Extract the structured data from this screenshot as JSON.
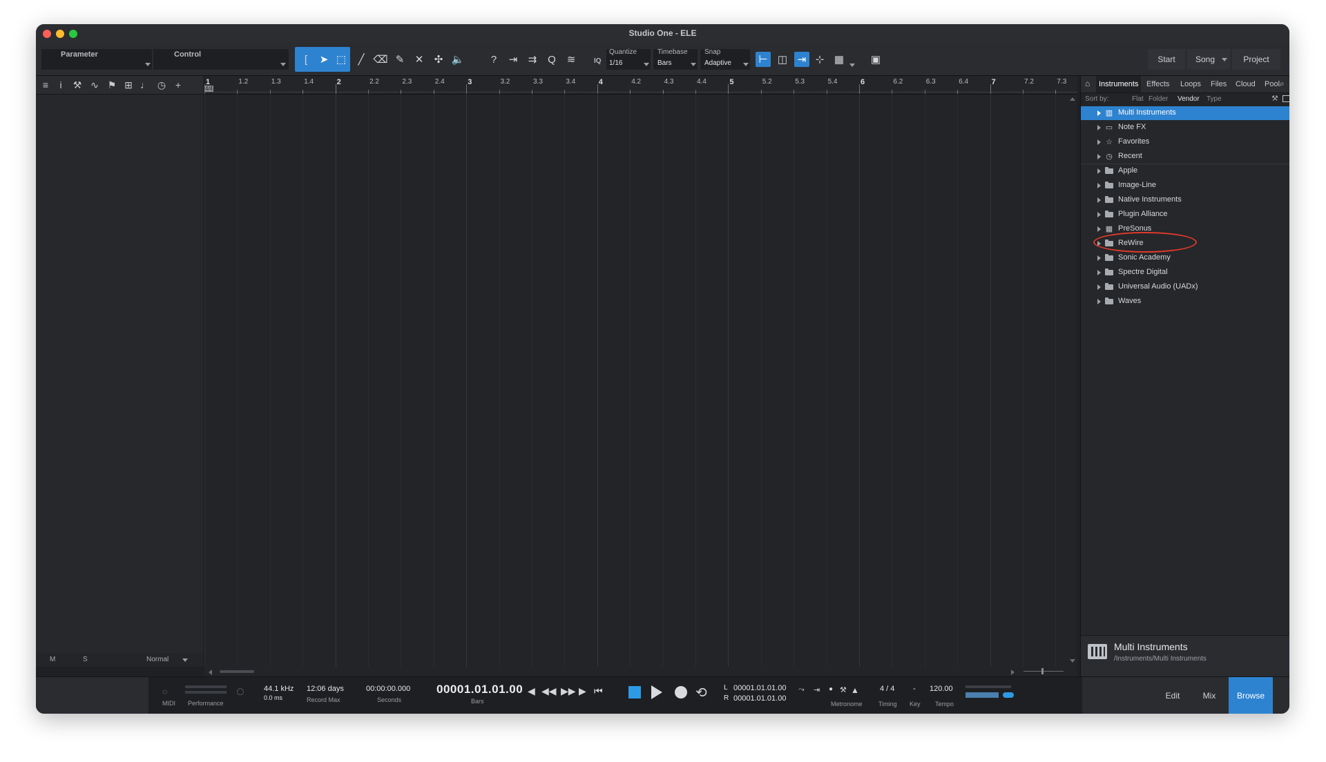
{
  "window": {
    "title": "Studio One - ELE"
  },
  "toolbar": {
    "parameter_label": "Parameter",
    "control_label": "Control",
    "iq_label": "IQ",
    "quantize_label": "Quantize",
    "quantize_value": "1/16",
    "timebase_label": "Timebase",
    "timebase_value": "Bars",
    "snap_label": "Snap",
    "snap_value": "Adaptive",
    "start_label": "Start",
    "song_label": "Song",
    "project_label": "Project"
  },
  "ruler": {
    "labels": [
      "1",
      "1.2",
      "1.3",
      "1.4",
      "2",
      "2.2",
      "2.3",
      "2.4",
      "3",
      "3.2",
      "3.3",
      "3.4",
      "4",
      "4.2",
      "4.3",
      "4.4",
      "5",
      "5.2",
      "5.3",
      "5.4",
      "6",
      "6.2",
      "6.3",
      "6.4",
      "7",
      "7.2",
      "7.3"
    ],
    "time_signature": "4/4"
  },
  "trackcol": {
    "mute_label": "M",
    "solo_label": "S",
    "mode_label": "Normal"
  },
  "browser": {
    "tabs": [
      "Instruments",
      "Effects",
      "Loops",
      "Files",
      "Cloud",
      "Pool"
    ],
    "active_tab": "Instruments",
    "sort_by_label": "Sort by:",
    "sort_options": [
      "Flat",
      "Folder",
      "Vendor",
      "Type"
    ],
    "active_sort": "Vendor",
    "items": [
      {
        "label": "Multi Instruments",
        "icon": "multi-instrument-folder-icon",
        "selected": true
      },
      {
        "label": "Note FX",
        "icon": "note-fx-folder-icon"
      },
      {
        "label": "Favorites",
        "icon": "star-icon"
      },
      {
        "label": "Recent",
        "icon": "clock-icon"
      },
      {
        "label": "Apple",
        "icon": "folder-icon"
      },
      {
        "label": "Image-Line",
        "icon": "folder-icon"
      },
      {
        "label": "Native Instruments",
        "icon": "folder-icon",
        "highlighted": true
      },
      {
        "label": "Plugin Alliance",
        "icon": "folder-icon"
      },
      {
        "label": "PreSonus",
        "icon": "presonus-icon"
      },
      {
        "label": "ReWire",
        "icon": "folder-icon"
      },
      {
        "label": "Sonic Academy",
        "icon": "folder-icon"
      },
      {
        "label": "Spectre Digital",
        "icon": "folder-icon"
      },
      {
        "label": "Universal Audio (UADx)",
        "icon": "folder-icon"
      },
      {
        "label": "Waves",
        "icon": "folder-icon"
      }
    ],
    "info": {
      "title": "Multi Instruments",
      "path": "/Instruments/Multi Instruments"
    }
  },
  "transport": {
    "midi_label": "MIDI",
    "performance_label": "Performance",
    "sample_rate": "44.1 kHz",
    "latency": "0.0 ms",
    "record_max_value": "12:06 days",
    "record_max_label": "Record Max",
    "seconds_value": "00:00:00.000",
    "seconds_label": "Seconds",
    "bars_value": "00001.01.01.00",
    "bars_label": "Bars",
    "loop_l_label": "L",
    "loop_l_value": "00001.01.01.00",
    "loop_r_label": "R",
    "loop_r_value": "00001.01.01.00",
    "metronome_label": "Metronome",
    "timing_value": "4 / 4",
    "timing_label": "Timing",
    "key_value": "-",
    "key_label": "Key",
    "tempo_value": "120.00",
    "tempo_label": "Tempo",
    "edit_label": "Edit",
    "mix_label": "Mix",
    "browse_label": "Browse"
  },
  "colors": {
    "accent": "#2e83d0",
    "highlight_circle": "#e23a2a"
  }
}
